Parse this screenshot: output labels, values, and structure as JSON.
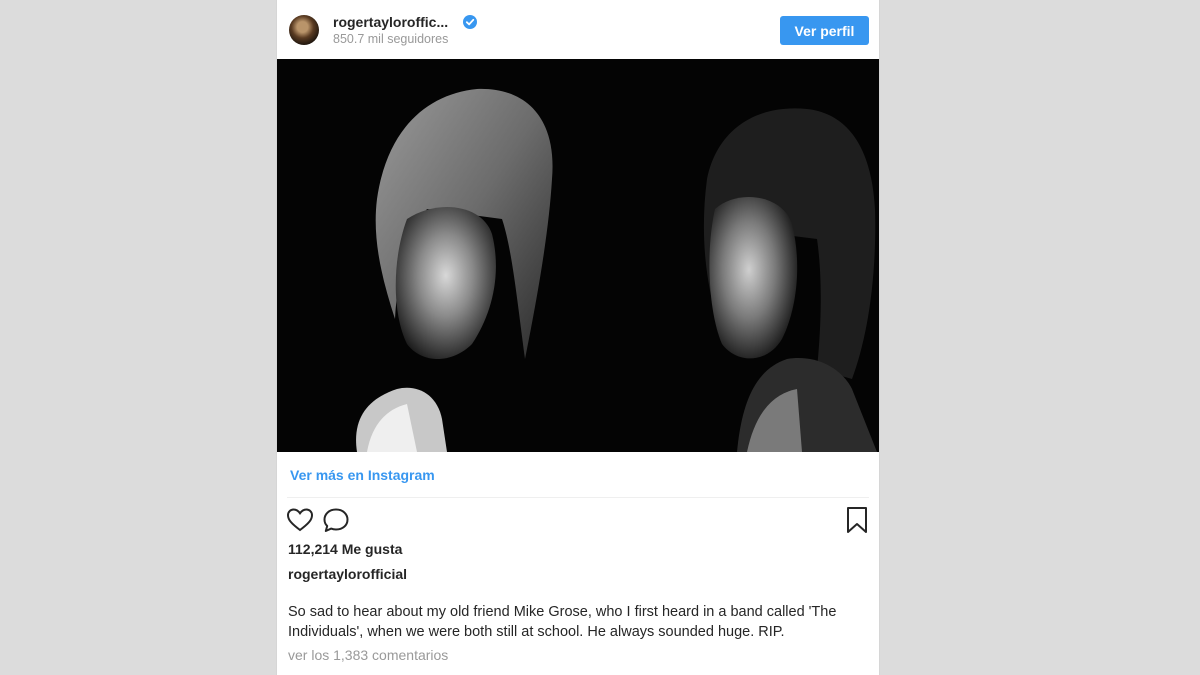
{
  "post": {
    "username": "rogertayloroffic...",
    "followers": "850.7 mil seguidores",
    "profile_button": "Ver perfil",
    "more_link": "Ver más en Instagram",
    "likes": "112,214 Me gusta",
    "author": "rogertaylorofficial",
    "caption": "So sad to hear about my old friend Mike Grose, who I first heard in a band called 'The Individuals', when we were both still at school. He always sounded huge. RIP.",
    "view_comments": "ver los 1,383 comentarios"
  },
  "icons": {
    "verified": "verified-badge-icon",
    "like": "heart-icon",
    "comment": "speech-bubble-icon",
    "save": "bookmark-icon"
  },
  "colors": {
    "accent": "#3897f0",
    "text": "#262626",
    "muted": "#999999",
    "background": "#dcdcdc"
  }
}
